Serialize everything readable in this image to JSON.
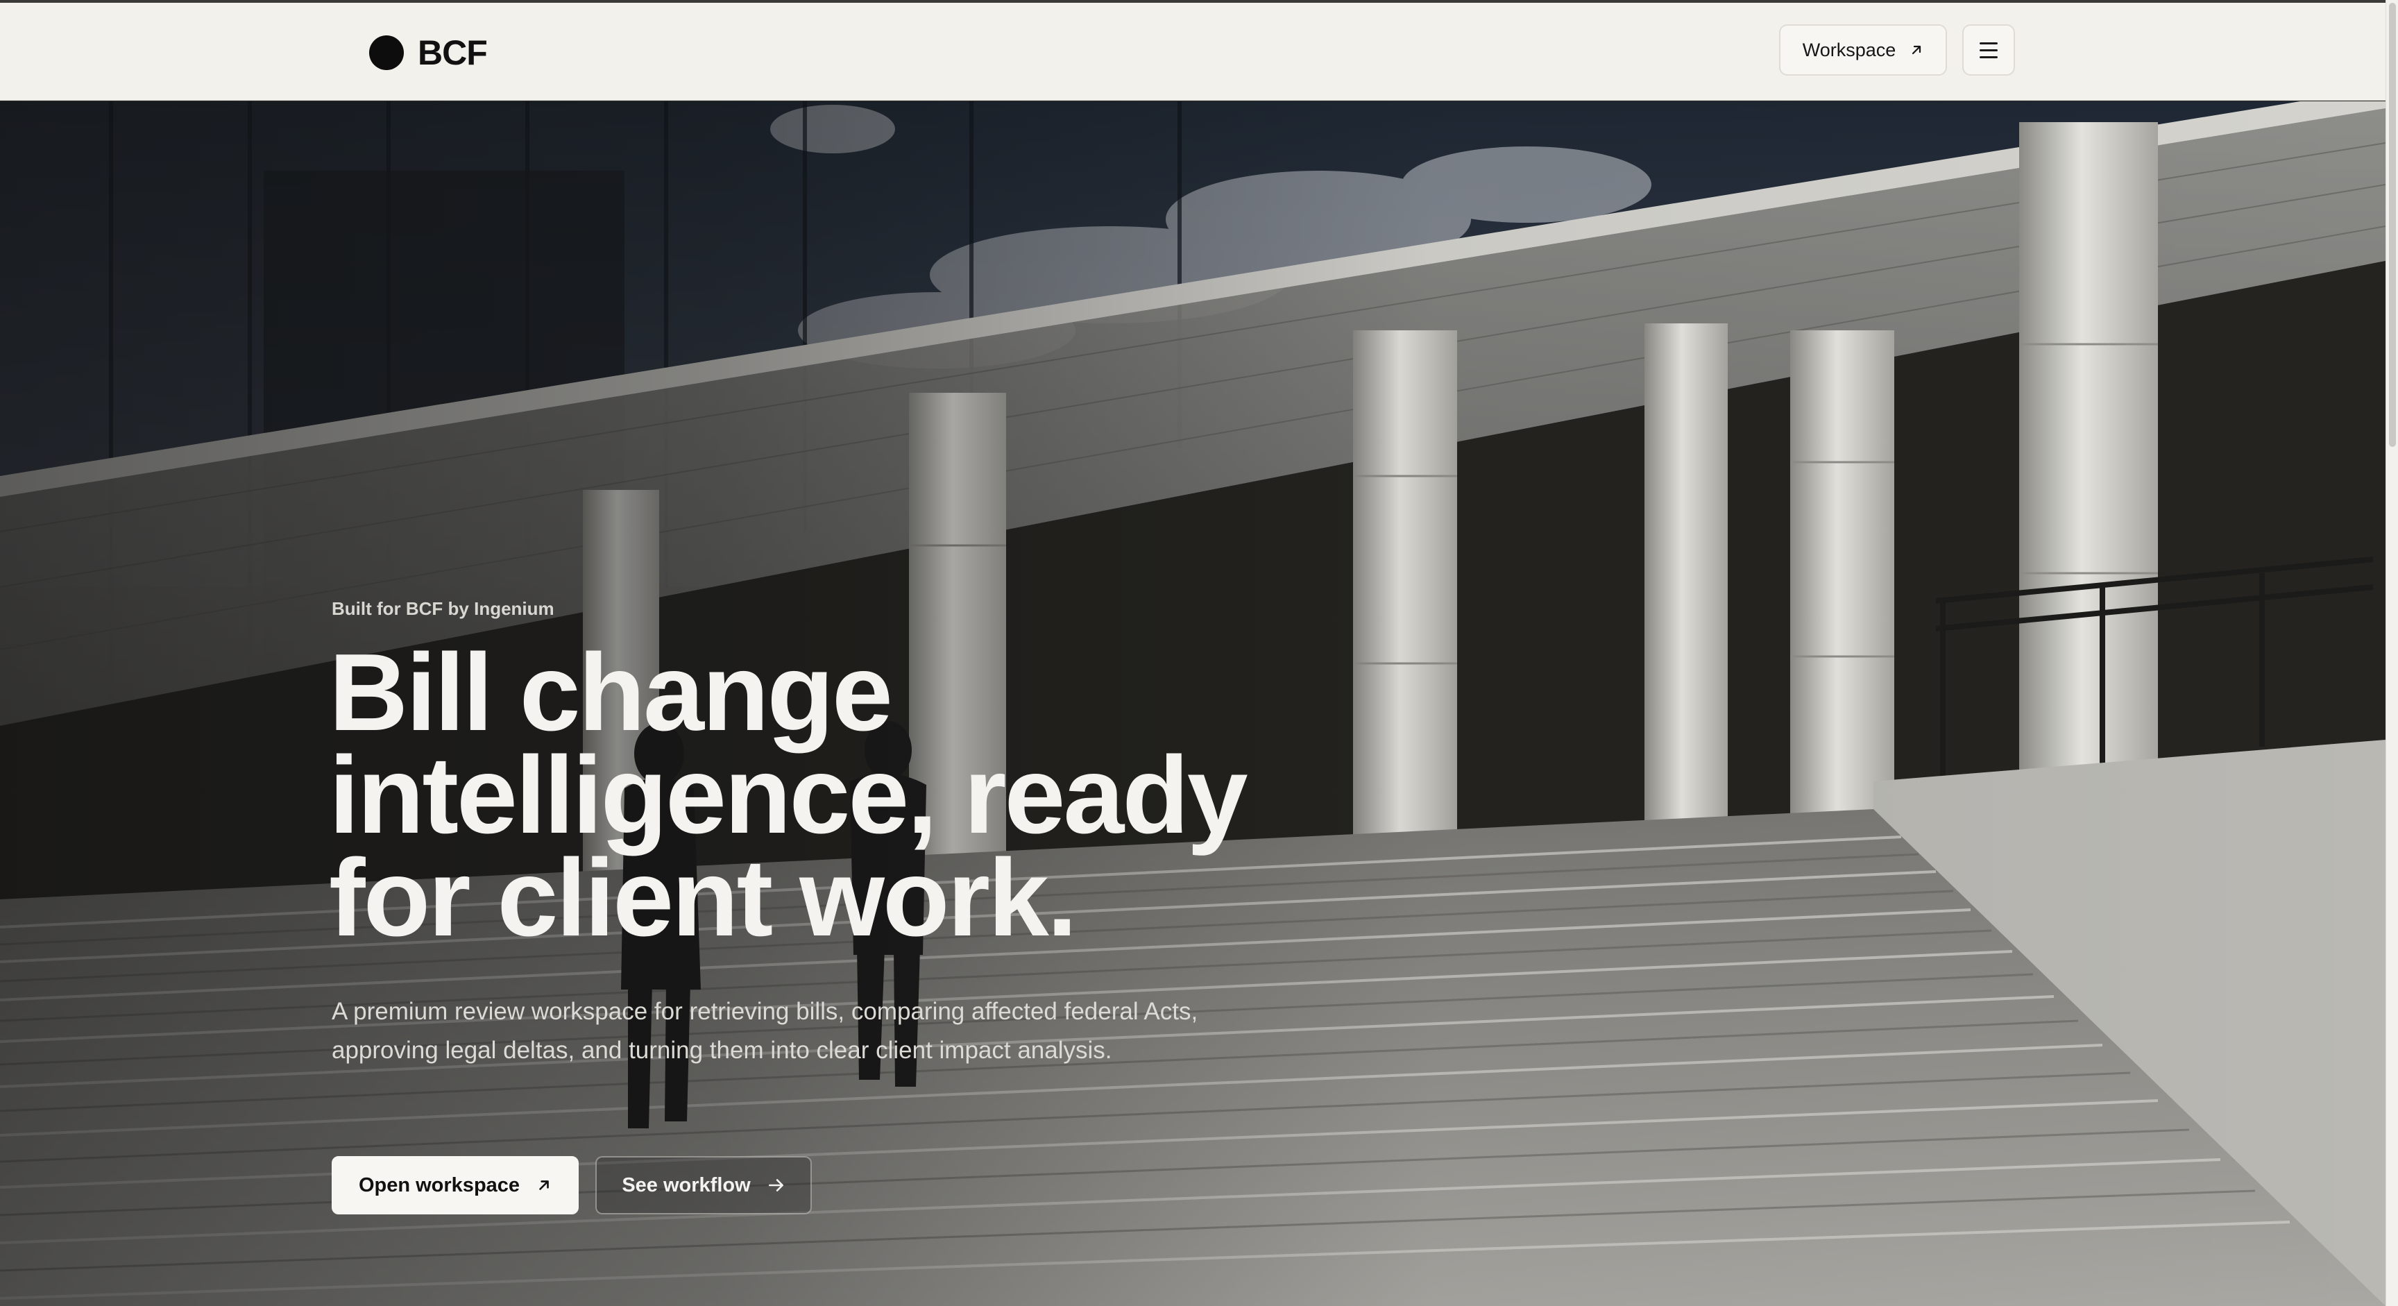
{
  "header": {
    "brand_name": "BCF",
    "workspace_label": "Workspace",
    "workspace_icon": "arrow-up-right-icon",
    "menu_icon": "hamburger-menu-icon"
  },
  "hero": {
    "background_image": "architectural photo: glass building facade with white columns, wide stone steps, two people in suits walking up",
    "eyebrow": "Built for BCF by Ingenium",
    "headline_lines": [
      "Bill change",
      "intelligence, ready",
      "for client work."
    ],
    "lede": "A premium review workspace for retrieving bills, comparing affected federal Acts, approving legal deltas, and turning them into clear client impact analysis.",
    "primary_cta": {
      "label": "Open workspace",
      "icon": "arrow-up-right-icon"
    },
    "secondary_cta": {
      "label": "See workflow",
      "icon": "arrow-right-icon"
    }
  },
  "colors": {
    "header_bg": "#f2f1ec",
    "hero_text": "#f4f3ef",
    "button_light_bg": "#f7f6f2",
    "ink": "#111111"
  }
}
